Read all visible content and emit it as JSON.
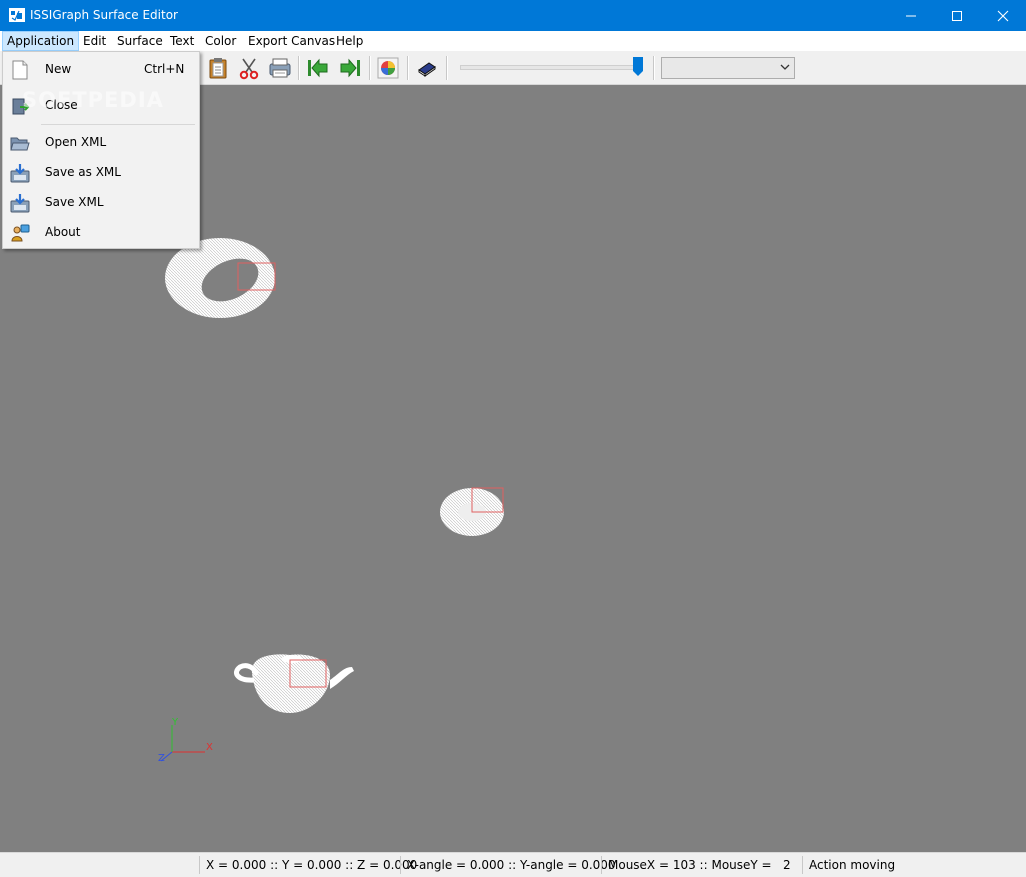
{
  "window": {
    "title": "ISSIGraph Surface Editor"
  },
  "menubar": {
    "items": [
      "Application",
      "Edit",
      "Surface",
      "Text",
      "Color",
      "Export Canvas",
      "Help"
    ]
  },
  "application_menu": {
    "items": [
      {
        "label": "New",
        "shortcut": "Ctrl+N",
        "icon": "new-document-icon"
      },
      {
        "label": "Close",
        "shortcut": "",
        "icon": "exit-icon"
      },
      {
        "label": "Open XML",
        "shortcut": "",
        "icon": "folder-open-icon"
      },
      {
        "label": "Save as XML",
        "shortcut": "",
        "icon": "save-as-icon"
      },
      {
        "label": "Save XML",
        "shortcut": "",
        "icon": "save-icon"
      },
      {
        "label": "About",
        "shortcut": "",
        "icon": "about-icon"
      }
    ]
  },
  "watermark": "SOFTPEDIA",
  "toolbar": {
    "buttons": [
      "paste-icon",
      "cut-icon",
      "printer-icon",
      "previous-icon",
      "next-icon",
      "color-picker-icon",
      "book-icon"
    ],
    "slider_level": 0.97,
    "combo_value": ""
  },
  "canvas": {
    "background_color": "#808080",
    "objects": [
      "torus-mesh",
      "disc-mesh",
      "teapot-mesh"
    ],
    "axis_labels": {
      "x": "X",
      "y": "Y",
      "z": "Z"
    }
  },
  "statusbar": {
    "coords": "X = 0.000 :: Y = 0.000 :: Z = 0.000",
    "angles": "X-angle = 0.000 :: Y-angle = 0.000",
    "mouse": "MouseX = 103 :: MouseY =   2",
    "action": "Action moving"
  },
  "colors": {
    "titlebar": "#0078d7",
    "accent_thumb": "#0078d7",
    "menu_highlight": "#cce8ff"
  }
}
